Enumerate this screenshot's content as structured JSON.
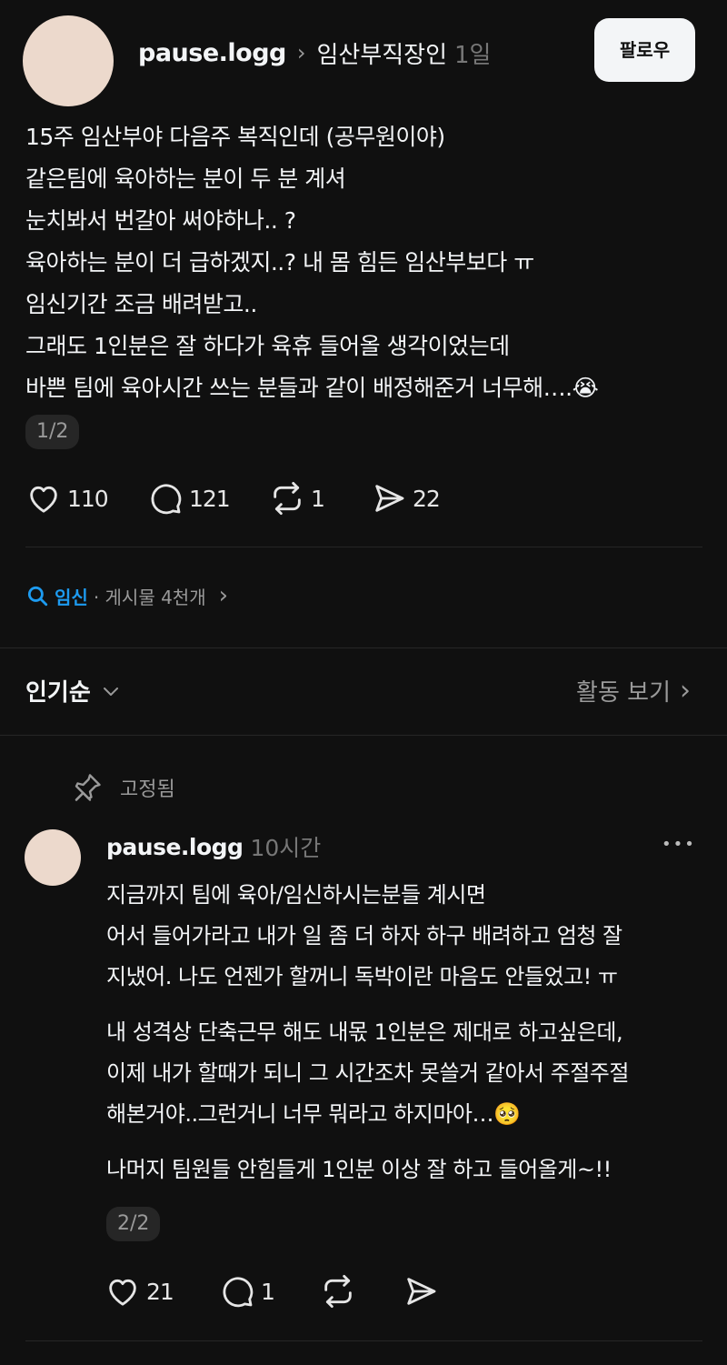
{
  "post": {
    "username": "pause.logg",
    "topic_tag": "임산부직장인",
    "time": "1일",
    "follow_label": "팔로우",
    "lines": [
      "15주 임산부야 다음주 복직인데 (공무원이야)",
      "같은팀에 육아하는 분이 두 분 계셔",
      "눈치봐서 번갈아 써야하나.. ?",
      "육아하는 분이 더 급하겠지..? 내 몸 힘든 임산부보다 ㅠ",
      "임신기간 조금 배려받고..",
      "그래도 1인분은 잘 하다가 육휴 들어올 생각이었는데",
      "바쁜 팀에 육아시간 쓰는 분들과 같이 배정해준거 너무해…."
    ],
    "emoji": "😭",
    "pager": "1/2",
    "likes": "110",
    "comments": "121",
    "reposts": "1",
    "shares": "22"
  },
  "topic": {
    "name": "임신",
    "posts": "· 게시물 4천개"
  },
  "sort": {
    "label": "인기순",
    "activity": "활동 보기"
  },
  "reply": {
    "pinned_label": "고정됨",
    "username": "pause.logg",
    "time": "10시간",
    "more": "•••",
    "para1": [
      "지금까지 팀에 육아/임신하시는분들 계시면",
      "어서 들어가라고 내가 일 좀 더 하자 하구 배려하고 엄청 잘",
      "지냈어. 나도 언젠가 할꺼니 독박이란 마음도 안들었고! ㅠ"
    ],
    "para2": [
      "내 성격상 단축근무 해도 내몫 1인분은 제대로 하고싶은데,",
      "이제 내가 할때가 되니 그 시간조차 못쓸거 같아서 주절주절",
      "해본거야..그런거니 너무 뭐라고 하지마아…"
    ],
    "emoji": "🥺",
    "para3": "나머지 팀원들 안힘들게 1인분 이상 잘 하고 들어올게~!!",
    "pager": "2/2",
    "likes": "21",
    "comments": "1"
  },
  "colors": {
    "background": "#101010",
    "text": "#f3f5f7",
    "accent_blue": "#1d9bf0",
    "avatar": "#ecd9cc"
  }
}
